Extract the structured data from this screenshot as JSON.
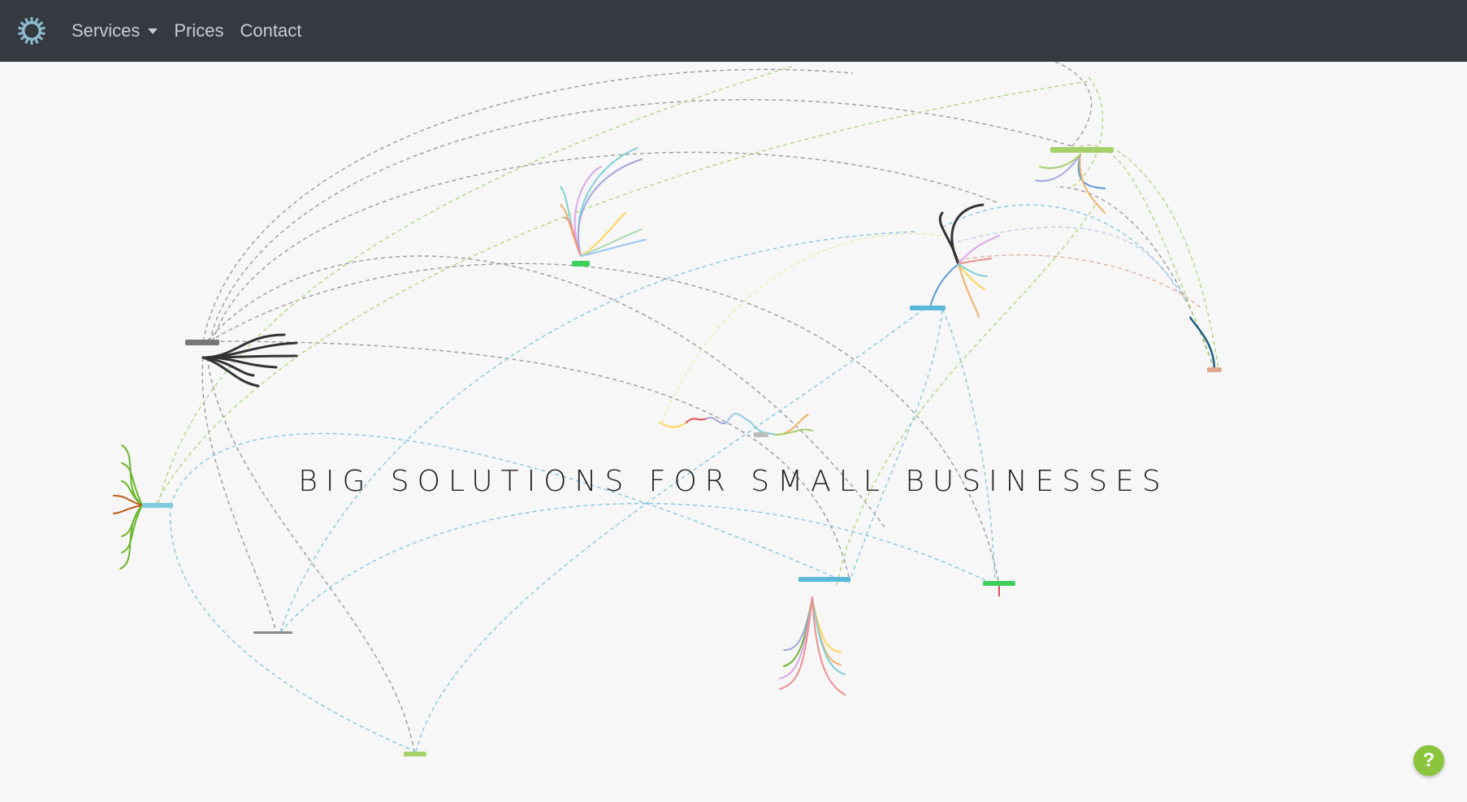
{
  "nav": {
    "logo_icon": "sun-gear-logo-icon",
    "services_label": "Services",
    "prices_label": "Prices",
    "contact_label": "Contact"
  },
  "hero": {
    "tagline": "BIG SOLUTIONS FOR SMALL BUSINESSES"
  },
  "help": {
    "label": "?"
  },
  "colors": {
    "navbar_bg": "#343a40",
    "nav_text": "#c9ccd0",
    "page_bg": "#f7f7f7",
    "help_button": "#8ac43c"
  }
}
